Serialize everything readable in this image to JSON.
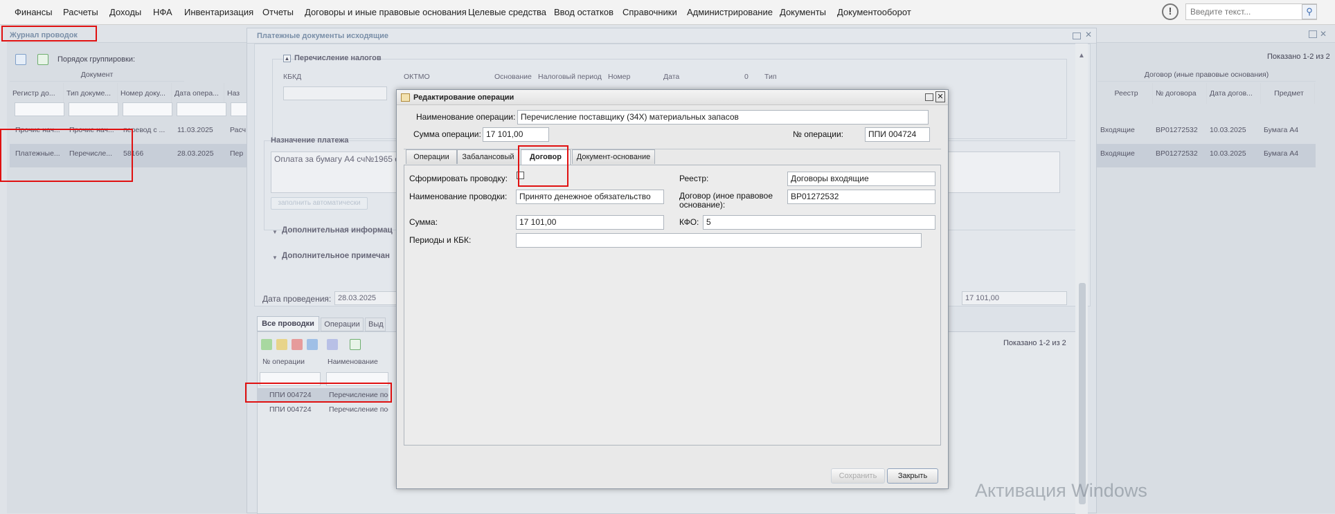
{
  "menu": [
    "Финансы",
    "Расчеты",
    "Доходы",
    "НФА",
    "Инвентаризация",
    "Отчеты",
    "Договоры и иные правовые основания",
    "Целевые средства",
    "Ввод остатков",
    "Справочники",
    "Администрирование",
    "Документы",
    "Документооборот"
  ],
  "search": {
    "placeholder": "Введите текст..."
  },
  "journal": {
    "title": "Журнал проводок",
    "grouping_label": "Порядок группировки:",
    "group_document": "Документ",
    "group_contract": "Договор (иные правовые основания)",
    "paging": "Показано 1-2 из 2",
    "columns": [
      "Регистр до...",
      "Тип докуме...",
      "Номер доку...",
      "Дата опера...",
      "Наз"
    ],
    "columns_right": [
      "Реестр",
      "№ договора",
      "Дата догов...",
      "Предмет"
    ],
    "rows": [
      [
        "Прочие нач...",
        "Прочие нач...",
        "перевод с ...",
        "11.03.2025",
        "Расч"
      ],
      [
        "Платежные...",
        "Перечисле...",
        "58166",
        "28.03.2025",
        "Пер"
      ]
    ],
    "rows_right": [
      [
        "Входящие",
        "BP01272532",
        "10.03.2025",
        "Бумага А4"
      ],
      [
        "Входящие",
        "BP01272532",
        "10.03.2025",
        "Бумага А4"
      ]
    ]
  },
  "payment_doc": {
    "title": "Платежные документы исходящие",
    "taxes_section": "Перечисление налогов",
    "tax_cols": [
      "КБКД",
      "ОКТМО",
      "Основание",
      "Налоговый период",
      "Номер",
      "Дата",
      "0",
      "Тип"
    ],
    "purpose_label": "Назначение платежа",
    "purpose_text": "Оплата за бумагу А4 сч№1965 о",
    "autofill": "заполнить автоматически",
    "extra_info": "Дополнительная информац",
    "extra_note": "Дополнительное примечан",
    "date_label": "Дата проведения:",
    "date_value": "28.03.2025",
    "sum_value": "17 101,00",
    "tabs": [
      "Все проводки",
      "Операции",
      "Выд"
    ],
    "paging": "Показано 1-2 из 2",
    "grid_cols": [
      "№ операции",
      "Наименование"
    ],
    "grid_rows": [
      [
        "ППИ 004724",
        "Перечисление пост"
      ],
      [
        "ППИ 004724",
        "Перечисление пост"
      ]
    ]
  },
  "modal": {
    "title": "Редактирование операции",
    "op_name_label": "Наименование операции:",
    "op_name_value": "Перечисление поставщику (34X) материальных запасов",
    "op_sum_label": "Сумма операции:",
    "op_sum_value": "17 101,00",
    "op_no_label": "№ операции:",
    "op_no_value": "ППИ 004724",
    "tabs": [
      "Операции",
      "Забалансовый",
      "Договор",
      "Документ-основание"
    ],
    "form_posting_label": "Сформировать проводку:",
    "posting_name_label": "Наименование проводки:",
    "posting_name_value": "Принято денежное обязательство",
    "sum_label": "Сумма:",
    "sum_value": "17 101,00",
    "periods_label": "Периоды и КБК:",
    "registry_label": "Реестр:",
    "registry_value": "Договоры входящие",
    "contract_label": "Договор (иное правовое основание):",
    "contract_value": "BP01272532",
    "kfo_label": "КФО:",
    "kfo_value": "5",
    "save_label": "Сохранить",
    "close_label": "Закрыть"
  },
  "watermark": "Активация Windows",
  "colors": {
    "highlight_red": "#e01010",
    "selected_row": "#c7ced8"
  }
}
